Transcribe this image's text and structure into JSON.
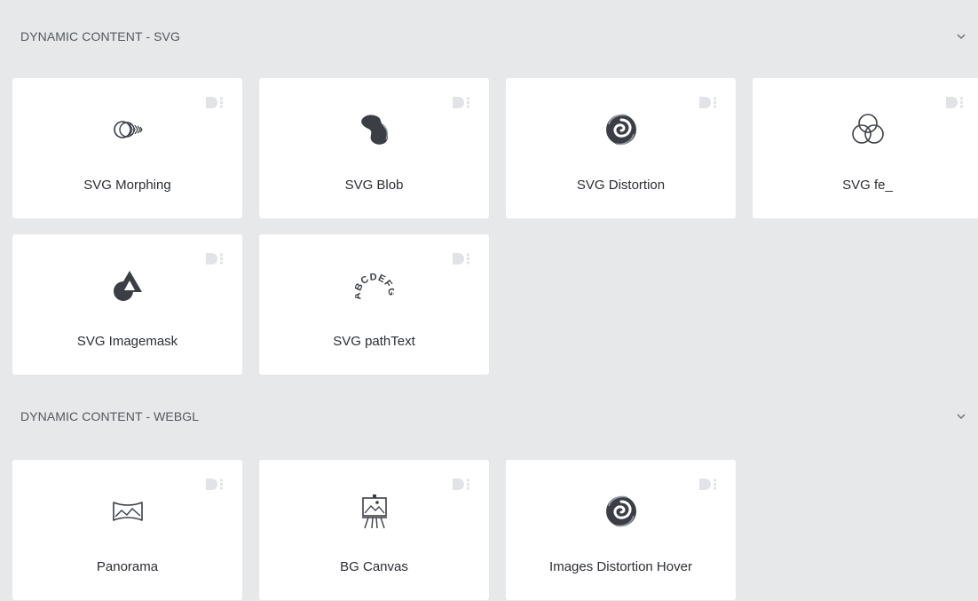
{
  "sections": [
    {
      "title": "DYNAMIC CONTENT - SVG",
      "widgets": [
        {
          "label": "SVG Morphing",
          "icon": "svg-morphing-icon"
        },
        {
          "label": "SVG Blob",
          "icon": "blob-icon"
        },
        {
          "label": "SVG Distortion",
          "icon": "distortion-swirl-icon"
        },
        {
          "label": "SVG fe_",
          "icon": "overlapping-circles-icon"
        },
        {
          "label": "SVG Imagemask",
          "icon": "image-mask-icon"
        },
        {
          "label": "SVG pathText",
          "icon": "path-text-icon",
          "icon_text": "ABCDEFG"
        }
      ]
    },
    {
      "title": "DYNAMIC CONTENT - WEBGL",
      "widgets": [
        {
          "label": "Panorama",
          "icon": "panorama-icon"
        },
        {
          "label": "BG Canvas",
          "icon": "easel-canvas-icon"
        },
        {
          "label": "Images Distortion Hover",
          "icon": "distortion-swirl-icon"
        }
      ]
    }
  ],
  "colors": {
    "background": "#e6e8ea",
    "card": "#ffffff",
    "icon": "#3b3f45",
    "badge": "#e3e5e8",
    "header_text": "#55595f"
  }
}
